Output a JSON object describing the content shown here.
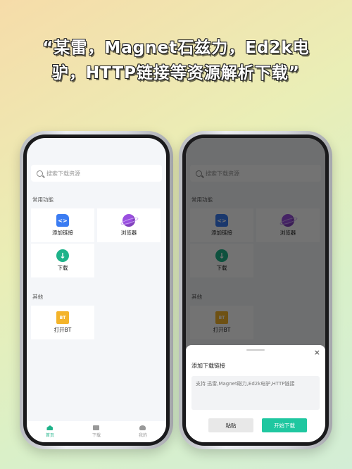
{
  "headline": {
    "line1": "“某雷，Magnet石兹力，Ed2k电",
    "line2": "驴，HTTP链接等资源解析下载”"
  },
  "app": {
    "search_placeholder": "搜索下载资源",
    "section_common": "常用功能",
    "section_other": "其他",
    "tiles": {
      "add_link": "添加链接",
      "browser": "浏览器",
      "download": "下载",
      "open_bt": "打开BT"
    },
    "tabbar": {
      "home": "首页",
      "downloads": "下载",
      "mine": "我的"
    }
  },
  "sheet": {
    "title": "添加下载链接",
    "input_placeholder": "支持 迅雷,Magnet磁力,Ed2k电驴,HTTP链接",
    "paste_label": "粘贴",
    "start_label": "开始下载",
    "close_glyph": "×"
  },
  "icons": {
    "bt_text": "BT",
    "link_glyph": "<>",
    "download_glyph": "↓"
  },
  "colors": {
    "accent": "#1fc7a0",
    "link_icon": "#3b7cf2",
    "browser_icon": "#9a4fe0",
    "bt_icon": "#f4b42a"
  }
}
